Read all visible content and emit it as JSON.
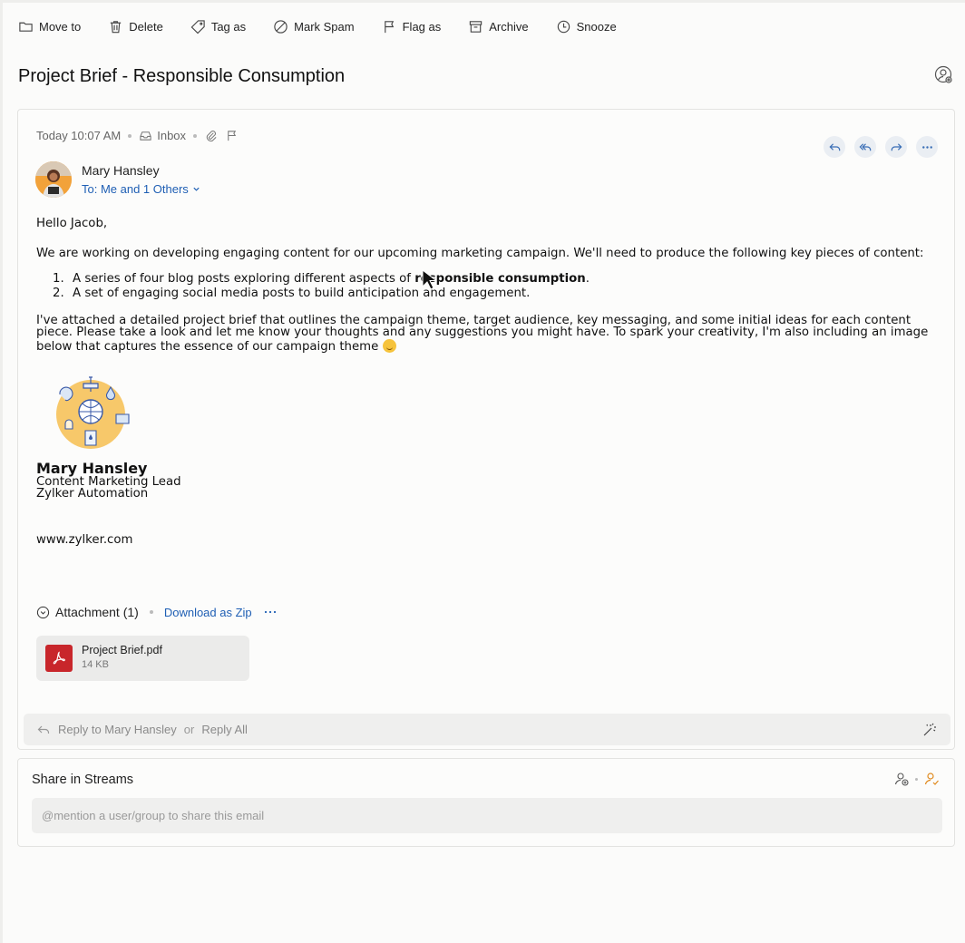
{
  "toolbar": {
    "move_to": "Move to",
    "delete": "Delete",
    "tag_as": "Tag as",
    "mark_spam": "Mark Spam",
    "flag_as": "Flag as",
    "archive": "Archive",
    "snooze": "Snooze"
  },
  "email": {
    "subject": "Project Brief - Responsible Consumption",
    "time": "Today 10:07 AM",
    "folder": "Inbox",
    "sender": "Mary Hansley",
    "to": "To: Me and 1 Others",
    "greeting": "Hello Jacob,",
    "para1": "We are working on developing engaging content for our upcoming marketing campaign. We'll need to produce the following key pieces of content:",
    "list": [
      {
        "num": "1.",
        "text": "A series of four blog posts exploring different aspects of ",
        "bold": "responsible consumption",
        "tail": "."
      },
      {
        "num": "2.",
        "text": "A set of engaging social media posts to build anticipation and engagement.",
        "bold": "",
        "tail": ""
      }
    ],
    "para2": "I've attached a detailed project brief that outlines the campaign theme, target audience, key messaging, and some initial ideas for each content piece. Please take a look and let me know your thoughts and any suggestions you might have. To spark your creativity, I'm also including an image below that captures the essence of our campaign theme ",
    "signature": {
      "name": "Mary Hansley",
      "title": "Content Marketing Lead",
      "company": "Zylker Automation"
    },
    "website": "www.zylker.com"
  },
  "attachments": {
    "header": "Attachment (1)",
    "download_zip": "Download as Zip",
    "more": "···",
    "items": [
      {
        "name": "Project Brief.pdf",
        "size": "14 KB"
      }
    ]
  },
  "reply": {
    "reply_to": "Reply to Mary Hansley",
    "or": "or",
    "reply_all": "Reply All"
  },
  "share": {
    "title": "Share in Streams",
    "placeholder": "@mention a user/group to share this email"
  },
  "colors": {
    "link": "#1f5fb4",
    "pdf": "#c8262b",
    "accent_orange": "#e08a1e"
  }
}
